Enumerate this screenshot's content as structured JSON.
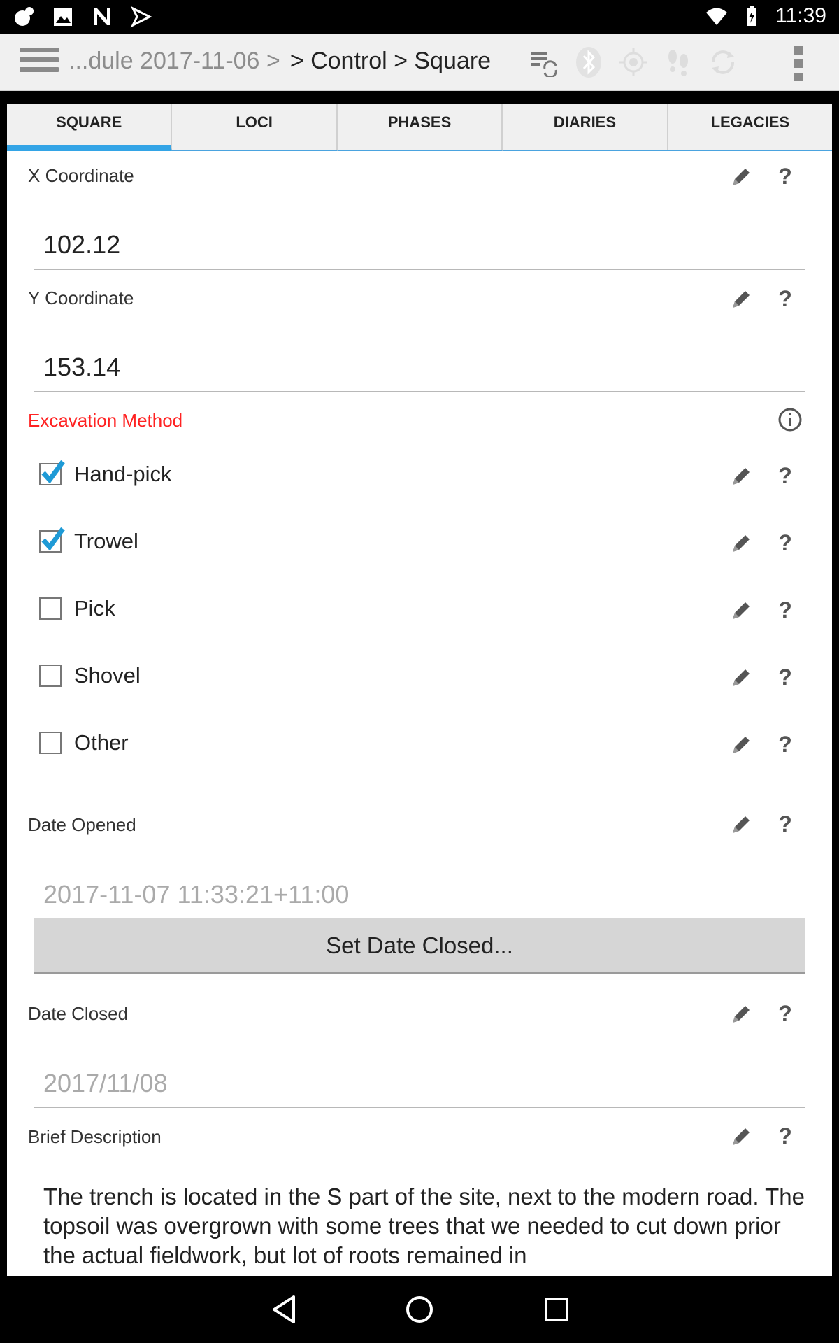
{
  "status_bar": {
    "time": "11:39",
    "left_icons": [
      "notification-icon",
      "image-icon",
      "n-icon",
      "download-icon"
    ],
    "right_icons": [
      "wifi-icon",
      "battery-icon"
    ]
  },
  "action_bar": {
    "breadcrumb_faded": "...dule 2017-11-06 >",
    "breadcrumb_main": "> Control > Square",
    "icons": [
      "sync-list-icon",
      "bluetooth-icon",
      "gps-icon",
      "footsteps-icon",
      "refresh-icon"
    ]
  },
  "tabs": [
    {
      "label": "SQUARE",
      "active": true
    },
    {
      "label": "LOCI",
      "active": false
    },
    {
      "label": "PHASES",
      "active": false
    },
    {
      "label": "DIARIES",
      "active": false
    },
    {
      "label": "LEGACIES",
      "active": false
    }
  ],
  "form": {
    "x_coordinate": {
      "label": "X Coordinate",
      "value": "102.12"
    },
    "y_coordinate": {
      "label": "Y Coordinate",
      "value": "153.14"
    },
    "excavation_method": {
      "label": "Excavation Method",
      "options": [
        {
          "label": "Hand-pick",
          "checked": true
        },
        {
          "label": "Trowel",
          "checked": true
        },
        {
          "label": "Pick",
          "checked": false
        },
        {
          "label": "Shovel",
          "checked": false
        },
        {
          "label": "Other",
          "checked": false
        }
      ]
    },
    "date_opened": {
      "label": "Date Opened",
      "value": "2017-11-07 11:33:21+11:00"
    },
    "set_date_closed_button": "Set Date Closed...",
    "date_closed": {
      "label": "Date Closed",
      "value": "2017/11/08"
    },
    "brief_description": {
      "label": "Brief Description",
      "value": "The trench is located in the S part of the site, next to the modern road. The topsoil was overgrown with some trees that we needed to cut down prior the actual fieldwork, but lot of roots remained in"
    },
    "help_glyph": "?"
  },
  "colors": {
    "accent": "#33a4e6",
    "required_label": "#ff2222",
    "checkbox_check": "#1e9ad6"
  }
}
